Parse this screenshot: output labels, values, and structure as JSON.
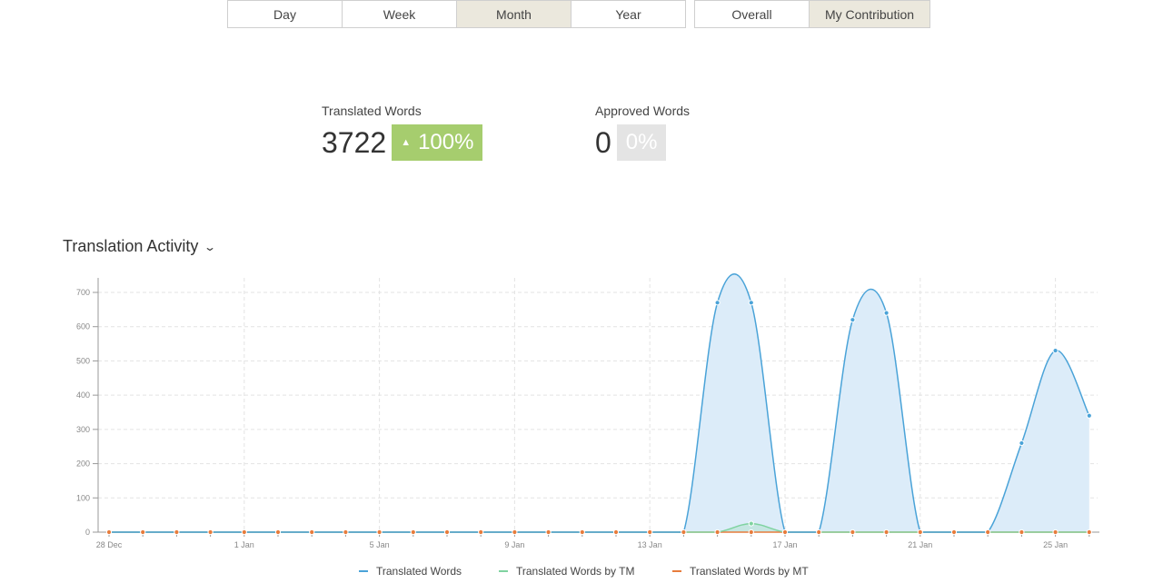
{
  "period_tabs": [
    {
      "label": "Day",
      "active": false
    },
    {
      "label": "Week",
      "active": false
    },
    {
      "label": "Month",
      "active": true
    },
    {
      "label": "Year",
      "active": false
    }
  ],
  "scope_tabs": [
    {
      "label": "Overall",
      "active": false
    },
    {
      "label": "My Contribution",
      "active": true
    }
  ],
  "stats": {
    "translated": {
      "label": "Translated Words",
      "value": "3722",
      "change": "100%",
      "change_icon": "up-triangle-icon"
    },
    "approved": {
      "label": "Approved Words",
      "value": "0",
      "change": "0%"
    }
  },
  "activity": {
    "title": "Translation Activity",
    "toggle_icon": "chevron-down-icon"
  },
  "colors": {
    "translated": "#4aa3d8",
    "translated_fill": "#dcecf9",
    "tm": "#7fd3a0",
    "mt": "#e77c3c",
    "badge_green": "#a6cd6e",
    "badge_grey": "#e4e4e4",
    "active_tab": "#ebe8dd"
  },
  "chart_data": {
    "type": "area",
    "x": [
      "28 Dec",
      "29 Dec",
      "30 Dec",
      "31 Dec",
      "1 Jan",
      "2 Jan",
      "3 Jan",
      "4 Jan",
      "5 Jan",
      "6 Jan",
      "7 Jan",
      "8 Jan",
      "9 Jan",
      "10 Jan",
      "11 Jan",
      "12 Jan",
      "13 Jan",
      "14 Jan",
      "15 Jan",
      "16 Jan",
      "17 Jan",
      "18 Jan",
      "19 Jan",
      "20 Jan",
      "21 Jan",
      "22 Jan",
      "23 Jan",
      "24 Jan",
      "25 Jan",
      "26 Jan"
    ],
    "x_tick_labels": [
      "28 Dec",
      "1 Jan",
      "5 Jan",
      "9 Jan",
      "13 Jan",
      "17 Jan",
      "21 Jan",
      "25 Jan"
    ],
    "ylim": [
      0,
      700
    ],
    "y_ticks": [
      0,
      100,
      200,
      300,
      400,
      500,
      600,
      700
    ],
    "grid": true,
    "legend_position": "bottom",
    "series": [
      {
        "name": "Translated Words",
        "values": [
          0,
          0,
          0,
          0,
          0,
          0,
          0,
          0,
          0,
          0,
          0,
          0,
          0,
          0,
          0,
          0,
          0,
          0,
          670,
          670,
          0,
          0,
          620,
          640,
          0,
          0,
          0,
          260,
          530,
          340
        ]
      },
      {
        "name": "Translated Words by TM",
        "values": [
          0,
          0,
          0,
          0,
          0,
          0,
          0,
          0,
          0,
          0,
          0,
          0,
          0,
          0,
          0,
          0,
          0,
          0,
          0,
          25,
          0,
          0,
          0,
          0,
          0,
          0,
          0,
          0,
          0,
          0
        ]
      },
      {
        "name": "Translated Words by MT",
        "values": [
          0,
          0,
          0,
          0,
          0,
          0,
          0,
          0,
          0,
          0,
          0,
          0,
          0,
          0,
          0,
          0,
          0,
          0,
          0,
          0,
          0,
          0,
          0,
          0,
          0,
          0,
          0,
          0,
          0,
          0
        ]
      }
    ]
  }
}
